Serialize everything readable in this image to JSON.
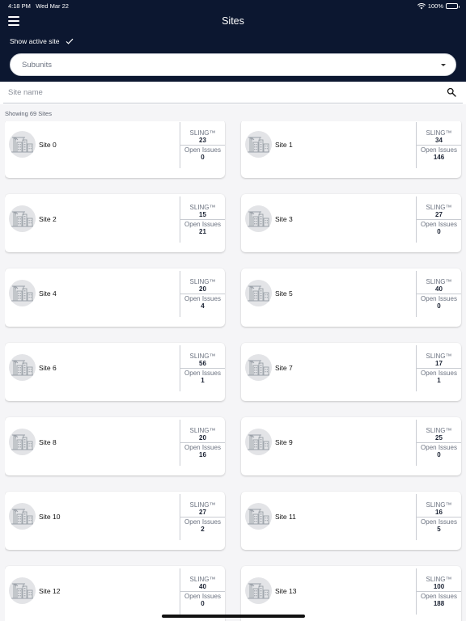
{
  "status_bar": {
    "time": "4:18 PM",
    "date": "Wed Mar 22",
    "battery": "100%"
  },
  "header": {
    "title": "Sites",
    "show_active_label": "Show active site"
  },
  "subunits": {
    "placeholder": "Subunits"
  },
  "search": {
    "placeholder": "Site name"
  },
  "showing": "Showing 69 Sites",
  "labels": {
    "sling": "SLING™",
    "open_issues": "Open Issues"
  },
  "colors": {
    "header_bg": "#0c1730",
    "background": "#f5f5f7"
  },
  "sites": [
    {
      "name": "Site 0",
      "sling": "23",
      "open_issues": "0"
    },
    {
      "name": "Site 1",
      "sling": "34",
      "open_issues": "146"
    },
    {
      "name": "Site 2",
      "sling": "15",
      "open_issues": "21"
    },
    {
      "name": "Site 3",
      "sling": "27",
      "open_issues": "0"
    },
    {
      "name": "Site 4",
      "sling": "20",
      "open_issues": "4"
    },
    {
      "name": "Site 5",
      "sling": "40",
      "open_issues": "0"
    },
    {
      "name": "Site 6",
      "sling": "56",
      "open_issues": "1"
    },
    {
      "name": "Site 7",
      "sling": "17",
      "open_issues": "1"
    },
    {
      "name": "Site 8",
      "sling": "20",
      "open_issues": "16"
    },
    {
      "name": "Site 9",
      "sling": "25",
      "open_issues": "0"
    },
    {
      "name": "Site 10",
      "sling": "27",
      "open_issues": "2"
    },
    {
      "name": "Site 11",
      "sling": "16",
      "open_issues": "5"
    },
    {
      "name": "Site 12",
      "sling": "40",
      "open_issues": "0"
    },
    {
      "name": "Site 13",
      "sling": "100",
      "open_issues": "188"
    }
  ]
}
